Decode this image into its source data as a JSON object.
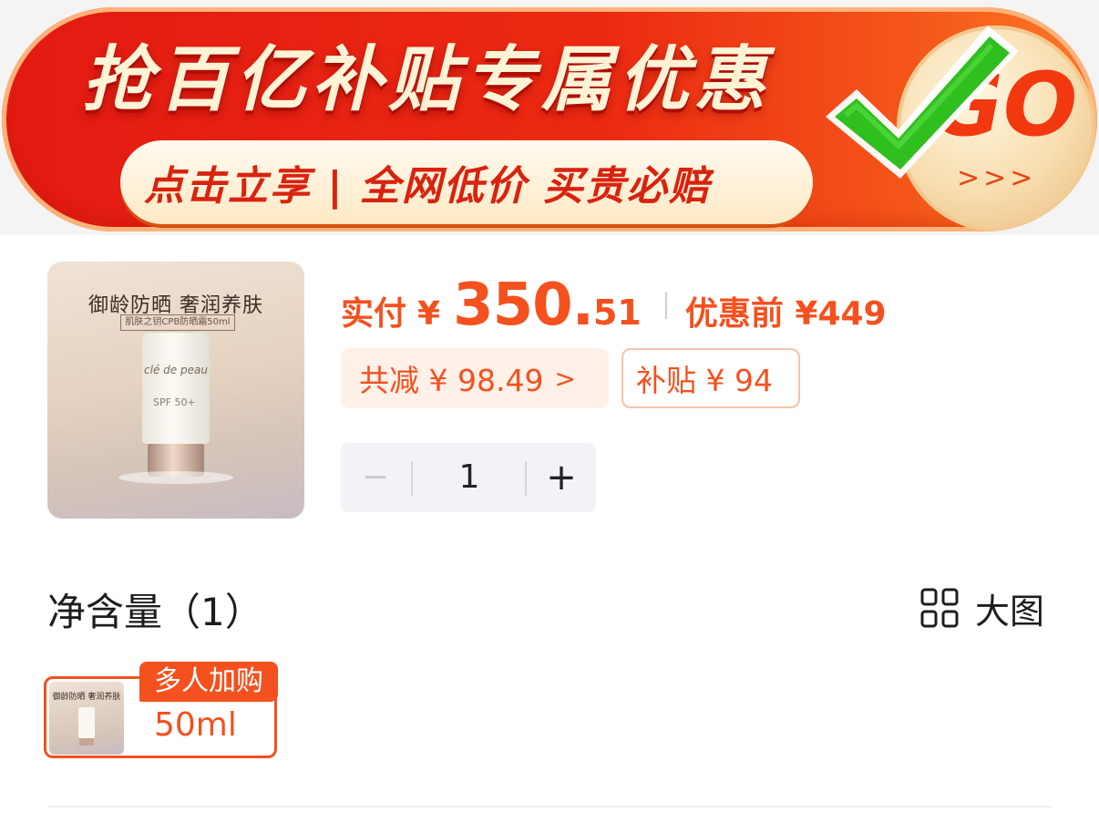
{
  "banner": {
    "title": "抢百亿补贴专属优惠",
    "subtitle": "点击立享 | 全网低价 买贵必赔",
    "go_text": "GO",
    "go_arrow": ">>>",
    "icons": [
      "check-icon"
    ]
  },
  "product": {
    "image_title": "御龄防晒 奢润养肤",
    "image_subtitle": "肌肤之钥CPB防晒霜50ml",
    "image_brand": "clé de peau",
    "image_spf": "SPF 50+",
    "price_label": "实付",
    "currency": "¥",
    "price_integer": "350.",
    "price_decimal": "51",
    "original_price": "优惠前 ¥449",
    "discount_chip": "共减 ¥ 98.49",
    "discount_chevron": ">",
    "subsidy_chip": "补贴 ¥ 94",
    "quantity": {
      "minus": "−",
      "value": "1",
      "plus": "+"
    }
  },
  "specs": {
    "title": "净含量（1）",
    "bigview_label": "大图",
    "options": [
      {
        "badge": "多人加购",
        "label": "50ml",
        "thumb_title": "御龄防晒 奢润养肤",
        "selected": true
      }
    ]
  },
  "colors": {
    "accent": "#f4511e",
    "banner_red": "#e31a12",
    "check_green": "#2fbf1f"
  }
}
